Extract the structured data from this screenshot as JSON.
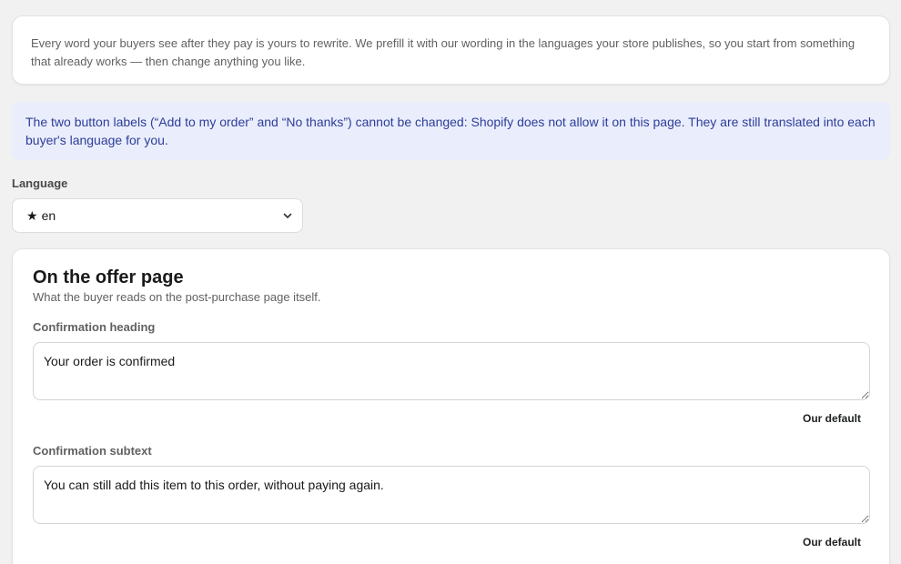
{
  "intro": {
    "text": "Every word your buyers see after they pay is yours to rewrite. We prefill it with our wording in the languages your store publishes, so you start from something that already works — then change anything you like."
  },
  "notice": {
    "text": "The two button labels (“Add to my order” and “No thanks”) cannot be changed: Shopify does not allow it on this page. They are still translated into each buyer's language for you."
  },
  "language": {
    "label": "Language",
    "star": "★",
    "selected": "en"
  },
  "offer_section": {
    "title": "On the offer page",
    "subtitle": "What the buyer reads on the post-purchase page itself.",
    "fields": [
      {
        "label": "Confirmation heading",
        "value": "Your order is confirmed",
        "default_label": "Our default"
      },
      {
        "label": "Confirmation subtext",
        "value": "You can still add this item to this order, without paying again.",
        "default_label": "Our default"
      }
    ]
  },
  "icons": {
    "select_chevron": "chevron-down-icon",
    "star": "star-icon"
  },
  "colors": {
    "background": "#f1f1f1",
    "card": "#ffffff",
    "banner_bg": "#eaedfc",
    "banner_text": "#2c3e99"
  }
}
